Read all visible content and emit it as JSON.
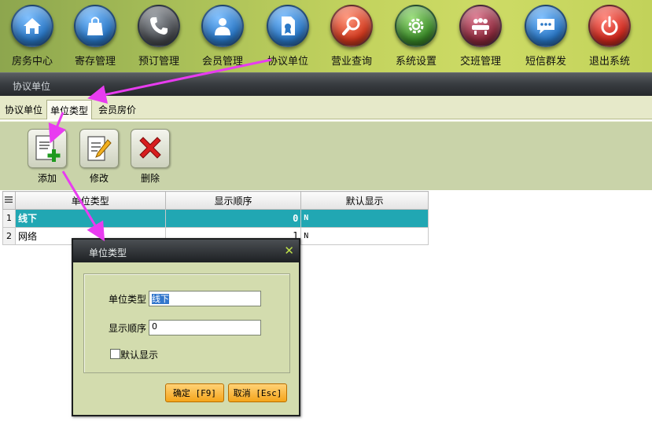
{
  "nav": {
    "items": [
      {
        "label": "房务中心",
        "icon": "house-icon",
        "color": "#2b78c6"
      },
      {
        "label": "寄存管理",
        "icon": "shopping-bag-icon",
        "color": "#2b78c6"
      },
      {
        "label": "预订管理",
        "icon": "phone-icon",
        "color": "#4a4d52"
      },
      {
        "label": "会员管理",
        "icon": "person-icon",
        "color": "#2b78c6"
      },
      {
        "label": "协议单位",
        "icon": "document-badge-icon",
        "color": "#2b78c6"
      },
      {
        "label": "营业查询",
        "icon": "magnifier-icon",
        "color": "#d33a1f"
      },
      {
        "label": "系统设置",
        "icon": "gear-icon",
        "color": "#3c8b2a"
      },
      {
        "label": "交班管理",
        "icon": "meeting-icon",
        "color": "#8c2a3d"
      },
      {
        "label": "短信群发",
        "icon": "chat-icon",
        "color": "#2b78c6"
      },
      {
        "label": "退出系统",
        "icon": "power-icon",
        "color": "#d32a1f"
      }
    ]
  },
  "titlebar": {
    "title": "协议单位"
  },
  "tabs": [
    {
      "label": "协议单位",
      "active": false
    },
    {
      "label": "单位类型",
      "active": true
    },
    {
      "label": "会员房价",
      "active": false
    }
  ],
  "toolbar": {
    "add_label": "添加",
    "edit_label": "修改",
    "delete_label": "删除"
  },
  "grid": {
    "corner_icon": "list-icon",
    "columns": [
      "单位类型",
      "显示顺序",
      "默认显示"
    ],
    "rows": [
      {
        "index": "1",
        "type": "线下",
        "order": "0",
        "default": "N"
      },
      {
        "index": "2",
        "type": "网络",
        "order": "1",
        "default": "N"
      }
    ]
  },
  "dialog": {
    "title": "单位类型",
    "type_label": "单位类型",
    "type_value": "线下",
    "order_label": "显示顺序",
    "order_value": "0",
    "default_label": "默认显示",
    "default_checked": false,
    "ok_label": "确定 [F9]",
    "cancel_label": "取消 [Esc]"
  },
  "colors": {
    "selection": "#21a7b3",
    "annotation_arrow": "#e83cf0",
    "button": "#f5a51b"
  }
}
